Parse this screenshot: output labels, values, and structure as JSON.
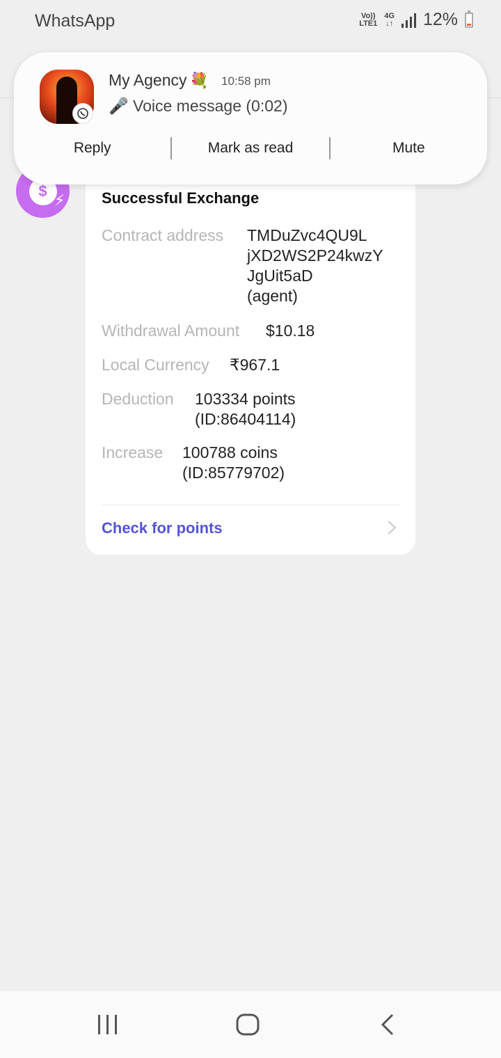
{
  "status_bar": {
    "app_name": "WhatsApp",
    "volte_top": "Vo))",
    "volte_bottom": "LTE1",
    "network_top": "4G",
    "network_bottom": "↓↑",
    "battery": "12%"
  },
  "notification": {
    "sender": "My Agency",
    "sender_emoji": "💐",
    "time": "10:58 pm",
    "message": "🎤 Voice message (0:02)",
    "actions": [
      "Reply",
      "Mark as read",
      "Mute"
    ]
  },
  "card": {
    "title": "Successful Exchange",
    "rows": [
      {
        "label": "Contract address",
        "value": "TMDuZvc4QU9L\njXD2WS2P24kwzY\nJgUit5aD\n(agent)"
      },
      {
        "label": "Withdrawal Amount",
        "value": "$10.18"
      },
      {
        "label": "Local Currency",
        "value": "₹967.1"
      },
      {
        "label": "Deduction",
        "value": "103334 points\n(ID:86404114)"
      },
      {
        "label": "Increase",
        "value": "100788 coins\n(ID:85779702)"
      }
    ],
    "link": "Check for points"
  },
  "bot_avatar": {
    "symbol": "$",
    "color": "#c66cf0"
  },
  "colors": {
    "accent": "#5454d8",
    "label": "#b5b5b5",
    "background": "#efeff0"
  }
}
